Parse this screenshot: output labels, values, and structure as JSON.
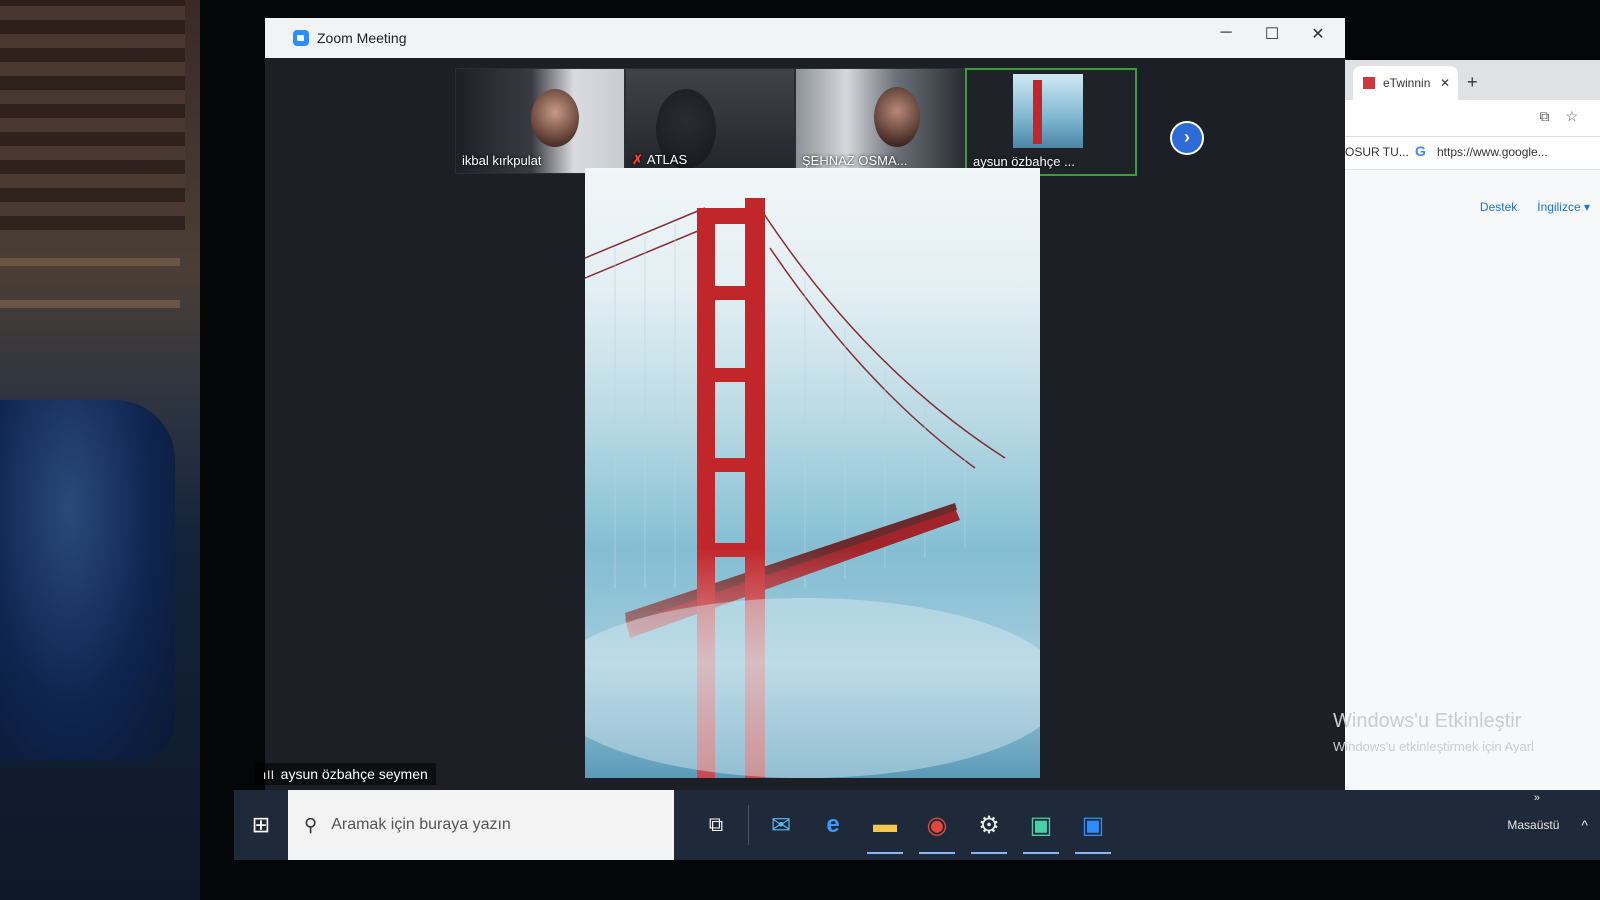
{
  "window": {
    "title": "Zoom Meeting",
    "controls": {
      "minimize": "─",
      "maximize": "☐",
      "close": "✕"
    }
  },
  "participants": [
    {
      "name": "ikbal kırkpulat",
      "muted": false
    },
    {
      "name": "ATLAS",
      "muted": true,
      "mic_icon": "✗"
    },
    {
      "name": "ŞEHNAZ OSMA...",
      "muted": false
    },
    {
      "name": "aysun özbahçe ...",
      "muted": false,
      "active_speaker": true
    }
  ],
  "next_page_icon": "›",
  "shared_screen": {
    "speaker_label": "aysun özbahçe seymen",
    "signal_icon": "ıll"
  },
  "browser": {
    "tab_label": "eTwinnin",
    "tab_close": "✕",
    "new_tab": "+",
    "bookmark_1": "OSUR TU...",
    "google_g": "G",
    "bookmark_url": "https://www.google...",
    "link_support": "Destek",
    "link_language": "İngilizce ▾",
    "watermark_title": "Windows'u Etkinleştir",
    "watermark_sub": "Windows'u etkinleştirmek için Ayarl"
  },
  "taskbar": {
    "start_icon": "⊞",
    "search_placeholder": "Aramak için buraya yazın",
    "search_icon": "⚲",
    "tray_desktop": "Masaüstü",
    "tray_chevron": "^",
    "tray_more": "»"
  },
  "colors": {
    "zoom_blue": "#2d8cff",
    "bridge_red": "#c0262a",
    "taskbar_bg": "#1e2a3a"
  }
}
